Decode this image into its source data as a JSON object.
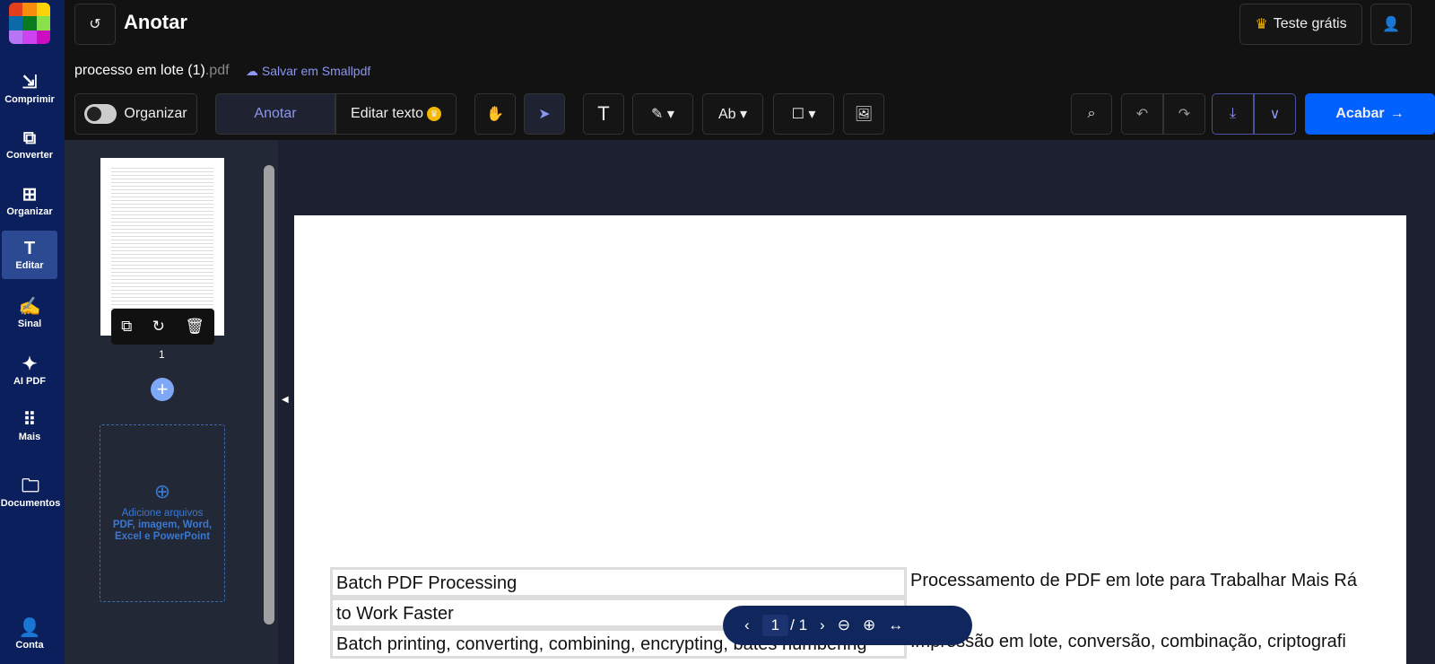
{
  "header": {
    "title": "Anotar",
    "file_name": "processo em lote (1)",
    "file_ext": ".pdf",
    "save_label": "Salvar em Smallpdf",
    "trial_label": "Teste grátis"
  },
  "sidebar": {
    "items": [
      {
        "label": "Comprimir",
        "icon": "compress-icon"
      },
      {
        "label": "Converter",
        "icon": "convert-icon"
      },
      {
        "label": "Organizar",
        "icon": "grid-icon"
      },
      {
        "label": "Editar",
        "icon": "text-icon",
        "active": true
      },
      {
        "label": "Sinal",
        "icon": "signature-icon"
      },
      {
        "label": "AI PDF",
        "icon": "sparkle-icon"
      },
      {
        "label": "Mais",
        "icon": "apps-icon"
      },
      {
        "label": "Documentos",
        "icon": "folder-icon"
      },
      {
        "label": "Conta",
        "icon": "user-icon"
      }
    ]
  },
  "toolbar": {
    "organize_label": "Organizar",
    "tab_annotate": "Anotar",
    "tab_edit_text": "Editar texto",
    "finish_label": "Acabar"
  },
  "thumbnails": {
    "page_number": "1",
    "add_files_line1": "Adicione arquivos",
    "add_files_line2": "PDF, imagem, Word,",
    "add_files_line3": "Excel e PowerPoint"
  },
  "document": {
    "rows": [
      {
        "left": "Batch PDF Processing",
        "right": "Processamento de PDF em lote para Trabalhar Mais Rá"
      },
      {
        "left": "to Work Faster",
        "right": ""
      },
      {
        "left": "Batch printing, converting, combining, encrypting, bates numbering",
        "right": "Impressão em lote, conversão, combinação, criptografi"
      }
    ]
  },
  "pager": {
    "current": "1",
    "total": "/ 1"
  },
  "colors": {
    "accent": "#0061fe",
    "sidebar": "#0b1f5c",
    "active_tool": "#8d96f0"
  }
}
